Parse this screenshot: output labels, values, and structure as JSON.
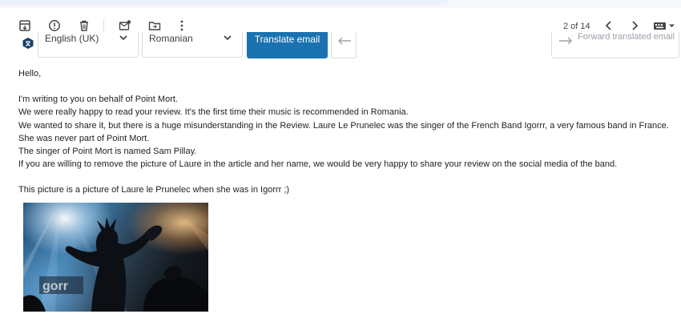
{
  "toolbar": {
    "icons": [
      "archive-icon",
      "report-spam-icon",
      "delete-icon",
      "mark-unread-icon",
      "move-to-icon",
      "more-vert-icon",
      "older-icon",
      "newer-icon",
      "input-tools-icon"
    ],
    "pager": "2 of 14"
  },
  "translate_bar": {
    "source_language": "English (UK)",
    "target_language": "Romanian",
    "translate_button": "Translate email",
    "forward_button": "Forward translated email"
  },
  "email": {
    "greeting": "Hello,",
    "paragraphs": [
      "I'm writing to you on behalf of Point Mort.",
      "We were really happy to read your review. It's the first time their music is recommended in Romania.",
      "We wanted to share it, but there is a huge misunderstanding in the Review. Laure Le Prunelec was the singer of the French Band Igorrr, a very famous band in France.",
      "She was never part of Point Mort.",
      "The singer of Point Mort is named Sam Pillay.",
      "If you are willing to remove the picture of Laure in the article and her name, we would be very happy to share your review on the social media of the band."
    ],
    "caption": "This picture is a picture of Laure le Prunelec when she was in Igorrr ;)",
    "photo_text": "gorr"
  },
  "colors": {
    "translate_button_bg": "#1a73b0",
    "border": "#dadce0",
    "toolbar_icon": "#444746"
  }
}
